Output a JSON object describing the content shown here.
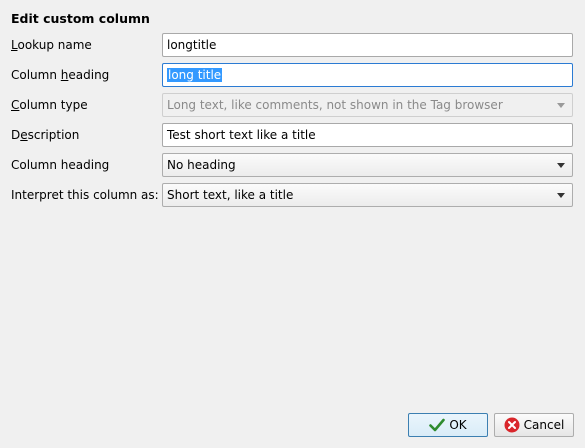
{
  "dialog": {
    "title": "Edit custom column"
  },
  "fields": {
    "lookup_name": {
      "label": "Lookup name",
      "value": "longtitle"
    },
    "column_heading": {
      "label": "Column heading",
      "value": "long title"
    },
    "column_type": {
      "label": "Column type",
      "value": "Long text, like comments, not shown in the Tag browser"
    },
    "description": {
      "label": "Description",
      "value": "Test short text like a title"
    },
    "column_heading_position": {
      "label": "Column heading",
      "value": "No heading"
    },
    "interpret_as": {
      "label": "Interpret this column as:",
      "value": "Short text, like a title"
    }
  },
  "buttons": {
    "ok": "OK",
    "cancel": "Cancel"
  },
  "icons": {
    "ok": "checkmark-icon",
    "cancel": "cancel-circle-icon"
  },
  "colors": {
    "ok_icon": "#2e8b2e",
    "cancel_icon": "#d9262b",
    "selection": "#3399ff"
  }
}
